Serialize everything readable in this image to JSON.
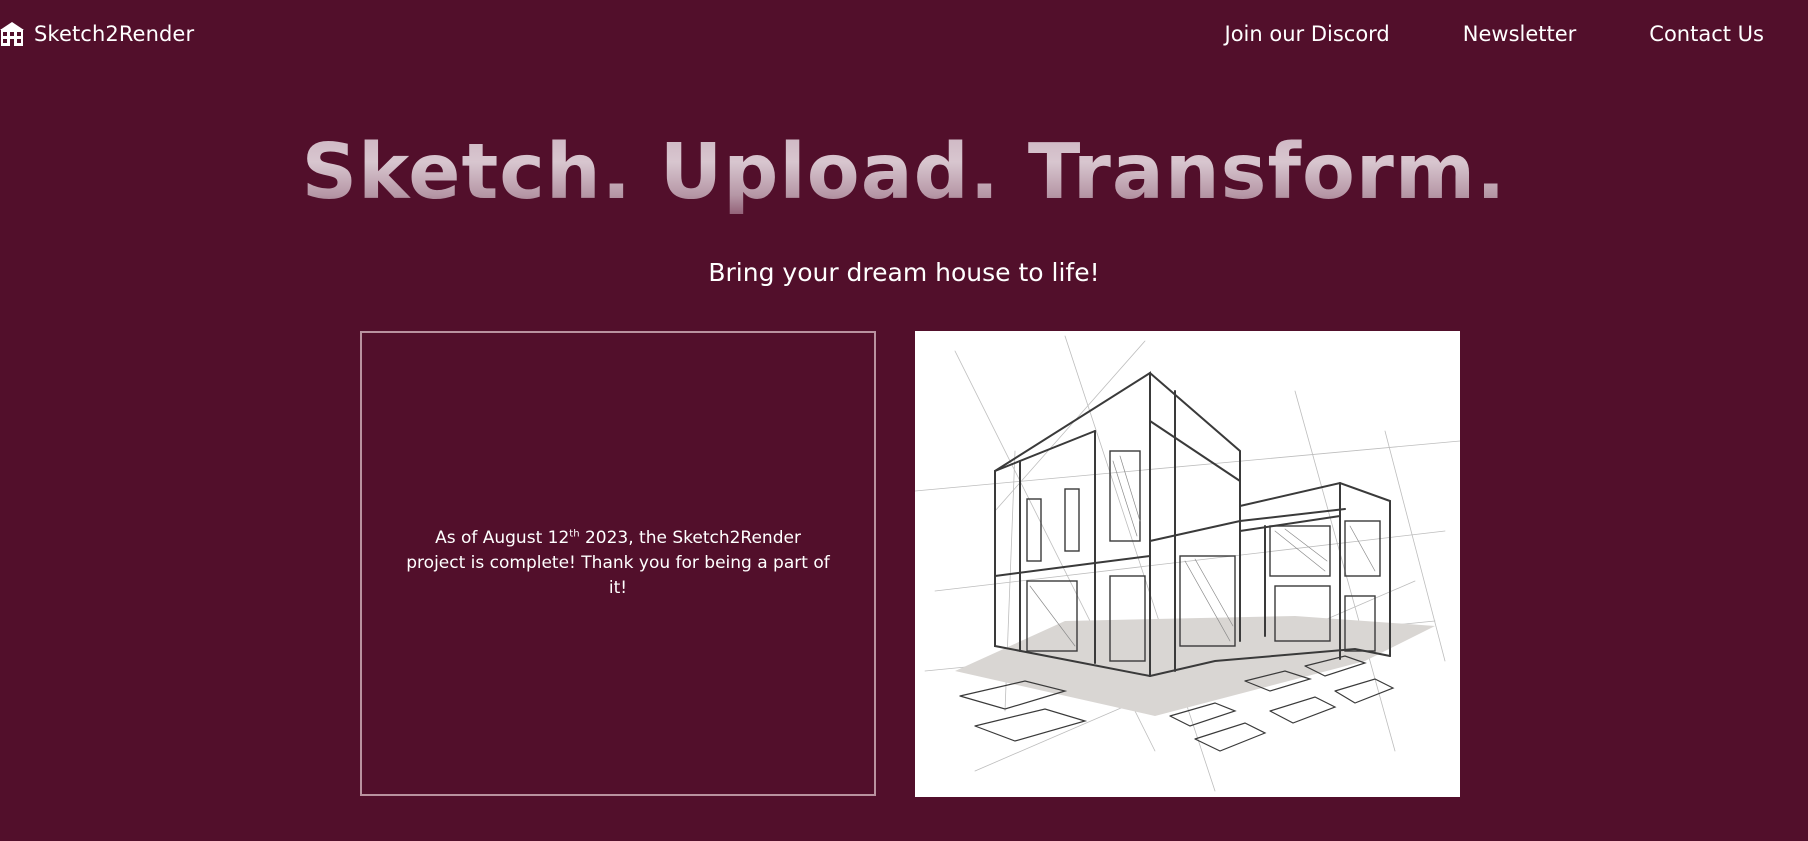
{
  "header": {
    "brand_name": "Sketch2Render",
    "brand_icon": "house-icon",
    "nav": [
      {
        "label": "Join our Discord"
      },
      {
        "label": "Newsletter"
      },
      {
        "label": "Contact Us"
      }
    ]
  },
  "hero": {
    "title": "Sketch. Upload. Transform.",
    "subtitle": "Bring your dream house to life!"
  },
  "notice": {
    "text_before_sup": "As of August 12",
    "sup": "th",
    "text_after_sup": " 2023, the Sketch2Render project is complete! Thank you for being a part of it!"
  },
  "illustration": {
    "icon": "house-sketch-illustration"
  },
  "colors": {
    "background": "#520f2b",
    "text": "#ffffff",
    "card_border": "#b9929f"
  }
}
